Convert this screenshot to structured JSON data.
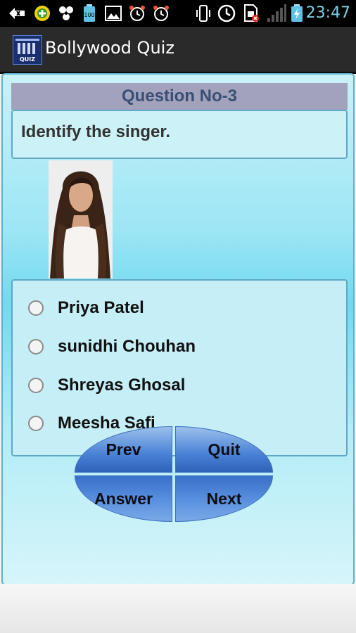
{
  "status_bar": {
    "time": "23:47",
    "battery_text": "100",
    "icons": [
      "back-arrow-icon",
      "plus-circle-icon",
      "bubbles-icon",
      "battery-100-icon",
      "gallery-icon",
      "alarm-icon",
      "alarm-icon",
      "phone-vibrate-icon",
      "clock-icon",
      "sim-blocked-icon",
      "signal-icon",
      "battery-charging-icon"
    ]
  },
  "app_bar": {
    "title": "Bollywood Quiz",
    "logo_text": "QUIZ"
  },
  "question": {
    "header": "Question No-3",
    "text": "Identify the singer."
  },
  "options": [
    {
      "label": "Priya Patel"
    },
    {
      "label": "sunidhi Chouhan"
    },
    {
      "label": "Shreyas Ghosal"
    },
    {
      "label": "Meesha Safi"
    }
  ],
  "buttons": {
    "prev": "Prev",
    "quit": "Quit",
    "answer": "Answer",
    "next": "Next"
  },
  "colors": {
    "status_time": "#7fd0e6",
    "header_bar": "#a2a2bd",
    "header_text": "#3a4f73",
    "button_blue": "#4a82d6"
  }
}
